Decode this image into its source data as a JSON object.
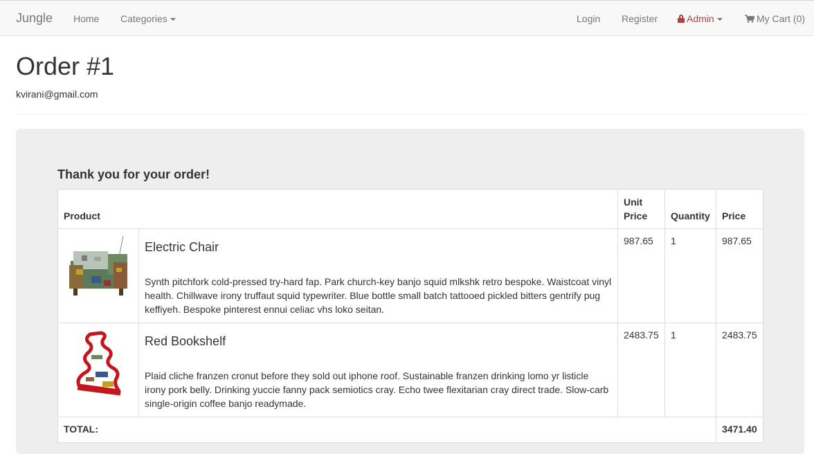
{
  "navbar": {
    "brand": "Jungle",
    "home": "Home",
    "categories": "Categories",
    "login": "Login",
    "register": "Register",
    "admin": "Admin",
    "cart": "My Cart (0)"
  },
  "order": {
    "title": "Order #1",
    "email": "kvirani@gmail.com",
    "thanks": "Thank you for your order!"
  },
  "table": {
    "headers": {
      "product": "Product",
      "unit_price": "Unit Price",
      "quantity": "Quantity",
      "price": "Price"
    },
    "items": [
      {
        "name": "Electric Chair",
        "description": "Synth pitchfork cold-pressed try-hard fap. Park church-key banjo squid mlkshk retro bespoke. Waistcoat vinyl health. Chillwave irony truffaut squid typewriter. Blue bottle small batch tattooed pickled bitters gentrify pug keffiyeh. Bespoke pinterest ennui celiac vhs loko seitan.",
        "unit_price": "987.65",
        "quantity": "1",
        "price": "987.65",
        "image_icon": "electric-chair-image"
      },
      {
        "name": "Red Bookshelf",
        "description": "Plaid cliche franzen cronut before they sold out iphone roof. Sustainable franzen drinking lomo yr listicle irony pork belly. Drinking yuccie fanny pack semiotics cray. Echo twee flexitarian cray direct trade. Slow-carb single-origin coffee banjo readymade.",
        "unit_price": "2483.75",
        "quantity": "1",
        "price": "2483.75",
        "image_icon": "red-bookshelf-image"
      }
    ],
    "total_label": "TOTAL:",
    "total_value": "3471.40"
  },
  "colors": {
    "navbar_bg": "#f8f8f8",
    "admin_red": "#a94442",
    "well_bg": "#eeeeee"
  }
}
